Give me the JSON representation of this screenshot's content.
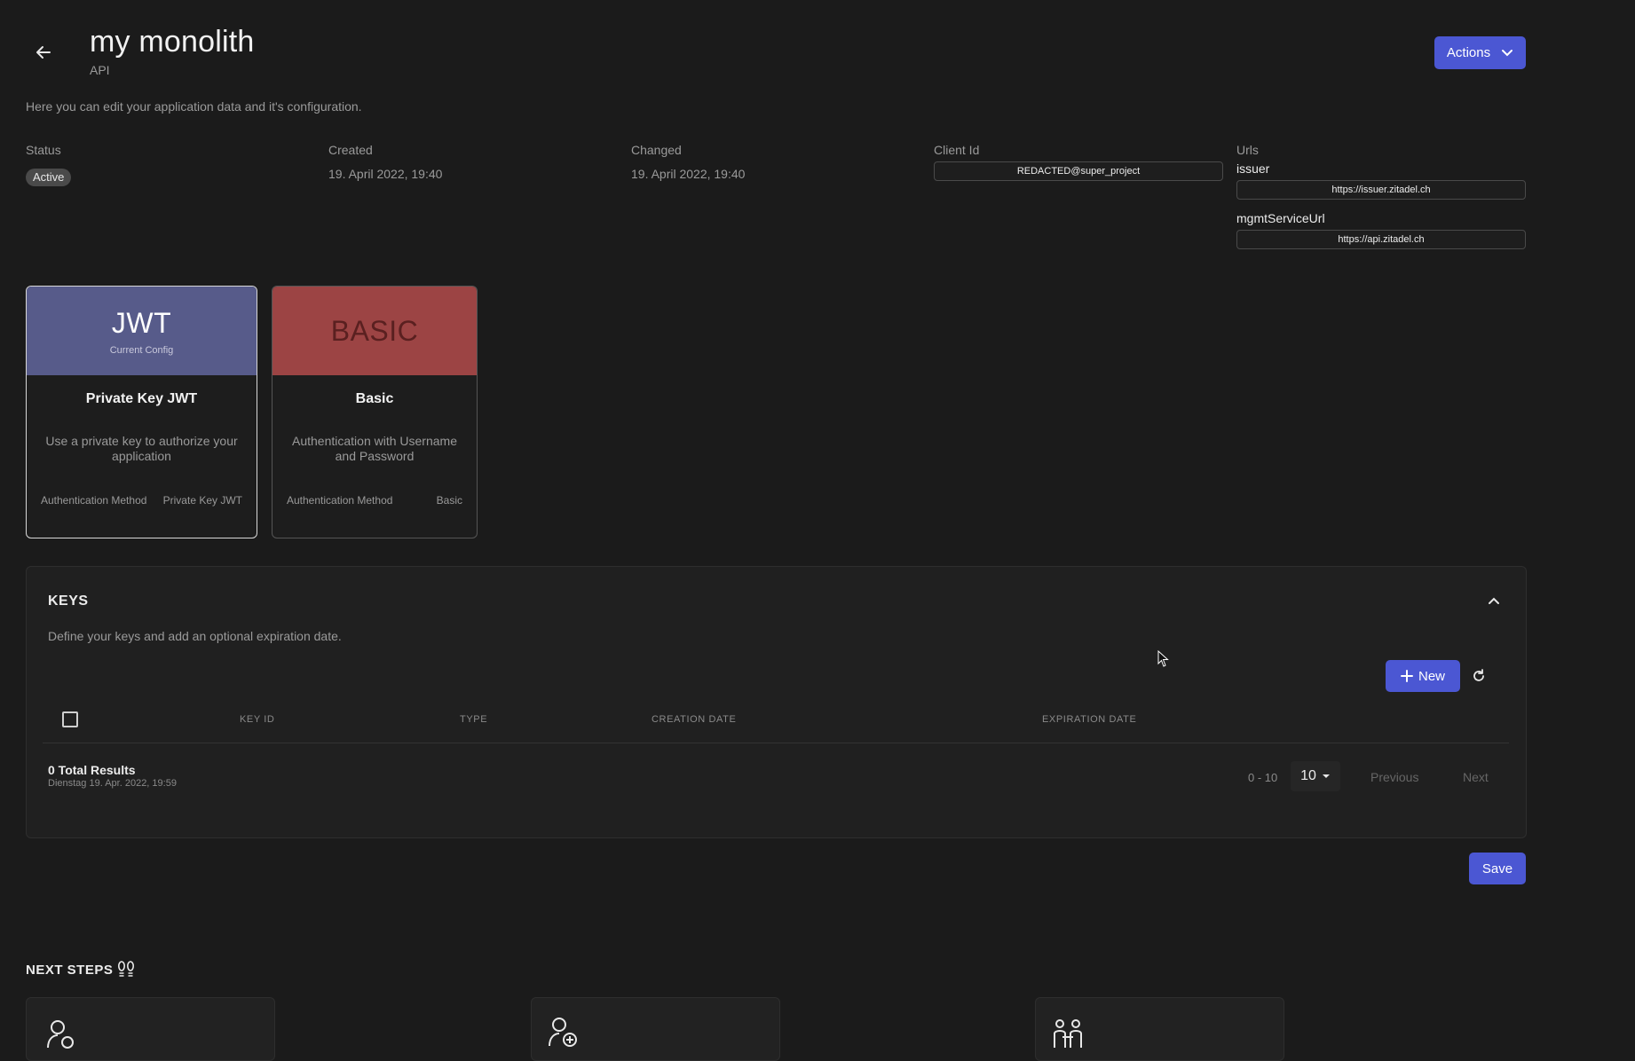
{
  "header": {
    "title": "my monolith",
    "subtitle": "API",
    "actions_label": "Actions",
    "description": "Here you can edit your application data and it's configuration."
  },
  "meta": {
    "status_label": "Status",
    "status_value": "Active",
    "created_label": "Created",
    "created_value": "19. April 2022, 19:40",
    "changed_label": "Changed",
    "changed_value": "19. April 2022, 19:40",
    "client_id_label": "Client Id",
    "client_id_value": "REDACTED@super_project",
    "urls_label": "Urls",
    "issuer_label": "issuer",
    "issuer_value": "https://issuer.zitadel.ch",
    "mgmt_label": "mgmtServiceUrl",
    "mgmt_value": "https://api.zitadel.ch"
  },
  "auth_methods": [
    {
      "badge": "JWT",
      "subbadge": "Current Config",
      "name": "Private Key JWT",
      "description": "Use a private key to authorize your application",
      "foot_label": "Authentication Method",
      "foot_value": "Private Key JWT",
      "head_color": "#575b8a"
    },
    {
      "badge": "BASIC",
      "subbadge": "",
      "name": "Basic",
      "description": "Authentication with Username and Password",
      "foot_label": "Authentication Method",
      "foot_value": "Basic",
      "head_color": "#9c4444"
    }
  ],
  "keys": {
    "title": "KEYS",
    "description": "Define your keys and add an optional expiration date.",
    "new_label": "New",
    "columns": [
      "KEY ID",
      "TYPE",
      "CREATION DATE",
      "EXPIRATION DATE"
    ],
    "total": "0 Total Results",
    "timestamp": "Dienstag 19. Apr. 2022, 19:59",
    "range": "0 - 10",
    "page_size": "10",
    "previous_label": "Previous",
    "next_label": "Next"
  },
  "save_label": "Save",
  "next_steps": {
    "title": "NEXT STEPS"
  },
  "colors": {
    "accent": "#4b57d3",
    "background": "#1b1b1b"
  }
}
